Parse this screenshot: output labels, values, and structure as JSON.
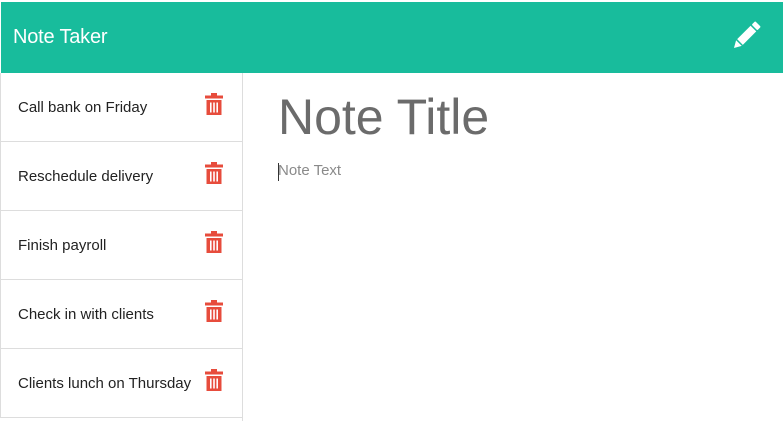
{
  "navbar": {
    "brand": "Note Taker",
    "background_color": "#18bc9c",
    "edit_icon": "pencil-icon"
  },
  "notes": [
    {
      "title": "Call bank on Friday"
    },
    {
      "title": "Reschedule delivery"
    },
    {
      "title": "Finish payroll"
    },
    {
      "title": "Check in with clients"
    },
    {
      "title": "Clients lunch on Thursday"
    }
  ],
  "delete_icon": "trash-icon",
  "delete_icon_color": "#e74c3c",
  "editor": {
    "title_placeholder": "Note Title",
    "text_placeholder": "Note Text"
  }
}
